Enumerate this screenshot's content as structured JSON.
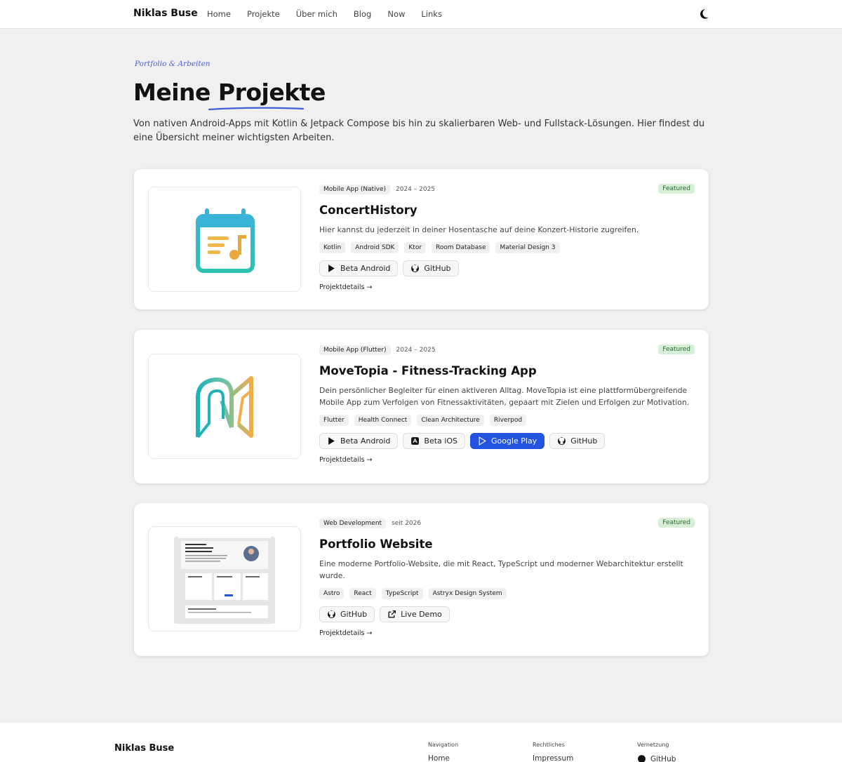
{
  "header": {
    "brand": "Niklas Buse",
    "nav": [
      "Home",
      "Projekte",
      "Über mich",
      "Blog",
      "Now",
      "Links"
    ],
    "theme_icon": "moon-icon"
  },
  "hero": {
    "eyebrow": "Portfolio & Arbeiten",
    "title": "Meine Projekte",
    "lead": "Von nativen Android-Apps mit Kotlin & Jetpack Compose bis hin zu skalierbaren Web- und Fullstack-Lösungen. Hier findest du eine Übersicht meiner wichtigsten Arbeiten."
  },
  "projects": [
    {
      "category": "Mobile App (Native)",
      "years": "2024 – 2025",
      "featured": "Featured",
      "title": "ConcertHistory",
      "description": "Hier kannst du jederzeit in deiner Hosentasche auf deine Konzert-Historie zugreifen.",
      "tags": [
        "Kotlin",
        "Android SDK",
        "Ktor",
        "Room Database",
        "Material Design 3"
      ],
      "links": [
        {
          "label": "Beta Android",
          "icon": "play-store-icon"
        },
        {
          "label": "GitHub",
          "icon": "github-icon"
        }
      ],
      "details": "Projektdetails →"
    },
    {
      "category": "Mobile App (Flutter)",
      "years": "2024 – 2025",
      "featured": "Featured",
      "title": "MoveTopia - Fitness-Tracking App",
      "description": "Dein persönlicher Begleiter für einen aktiveren Alltag. MoveTopia ist eine plattformübergreifende Mobile App zum Verfolgen von Fitnessaktivitäten, gepaart mit Zielen und Erfolgen zur Motivation.",
      "tags": [
        "Flutter",
        "Health Connect",
        "Clean Architecture",
        "Riverpod"
      ],
      "links": [
        {
          "label": "Beta Android",
          "icon": "play-store-icon"
        },
        {
          "label": "Beta iOS",
          "icon": "app-store-icon"
        },
        {
          "label": "Google Play",
          "icon": "play-store-icon"
        },
        {
          "label": "GitHub",
          "icon": "github-icon"
        }
      ],
      "details": "Projektdetails →"
    },
    {
      "category": "Web Development",
      "years": "seit 2026",
      "featured": "Featured",
      "title": "Portfolio Website",
      "description": "Eine moderne Portfolio-Website, die mit React, TypeScript und moderner Webarchitektur erstellt wurde.",
      "tags": [
        "Astro",
        "React",
        "TypeScript",
        "Astryx Design System"
      ],
      "links": [
        {
          "label": "GitHub",
          "icon": "github-icon"
        },
        {
          "label": "Live Demo",
          "icon": "external-link-icon"
        }
      ],
      "details": "Projektdetails →"
    }
  ],
  "footer": {
    "brand": "Niklas Buse",
    "columns": [
      {
        "heading": "Navigation",
        "first": "Home"
      },
      {
        "heading": "Rechtliches",
        "first": "Impressum"
      },
      {
        "heading": "Vernetzung",
        "first": "GitHub"
      }
    ]
  }
}
